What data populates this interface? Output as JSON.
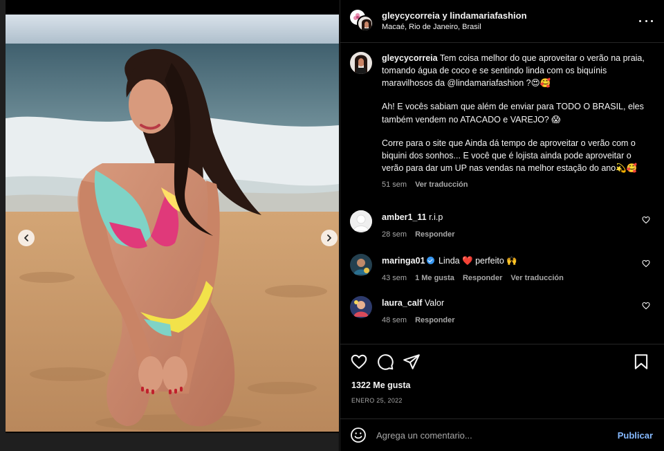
{
  "header": {
    "authors": "gleycycorreia y lindamariafashion",
    "location": "Macaé, Rio de Janeiro, Brasil"
  },
  "caption": {
    "username": "gleycycorreia",
    "paragraph1": "Tem coisa melhor do que aproveitar o verão na praia, tomando água de coco e se sentindo linda com os biquínis maravilhosos da @lindamariafashion ?😍🥰",
    "paragraph2": "Ah! E vocês sabiam que além de enviar para TODO O BRASIL, eles também vendem no ATACADO e VAREJO? 😱",
    "paragraph3": "Corre para o site que Ainda dá tempo de aproveitar o verão com o biquini dos sonhos... E você que é lojista ainda pode aproveitar o verão para dar um UP nas vendas na melhor estação do ano💫🥰",
    "time": "51 sem",
    "translate": "Ver traducción"
  },
  "comments": [
    {
      "username": "amber1_11",
      "text": "r.i.p",
      "time": "28 sem",
      "likes": "",
      "reply": "Responder",
      "translate": ""
    },
    {
      "username": "maringa01",
      "verified": true,
      "text": "Linda ❤️ perfeito 🙌",
      "time": "43 sem",
      "likes": "1 Me gusta",
      "reply": "Responder",
      "translate": "Ver traducción"
    },
    {
      "username": "laura_calf",
      "text": "Valor",
      "time": "48 sem",
      "likes": "",
      "reply": "Responder",
      "translate": ""
    }
  ],
  "stats": {
    "likes": "1322 Me gusta",
    "date": "ENERO 25, 2022"
  },
  "composer": {
    "placeholder": "Agrega un comentario...",
    "publish": "Publicar"
  },
  "carousel": {
    "total": 4,
    "current": 3
  },
  "icons": [
    "heart-icon",
    "comment-icon",
    "share-icon",
    "bookmark-icon",
    "emoji-icon",
    "more-icon",
    "chevron-left-icon",
    "chevron-right-icon"
  ],
  "colors": {
    "background": "#000000",
    "text": "#f5f5f5",
    "muted": "#a8a8a8",
    "link": "#85b9ff",
    "heart_red": "#ed4956",
    "verified": "#3897f0"
  }
}
